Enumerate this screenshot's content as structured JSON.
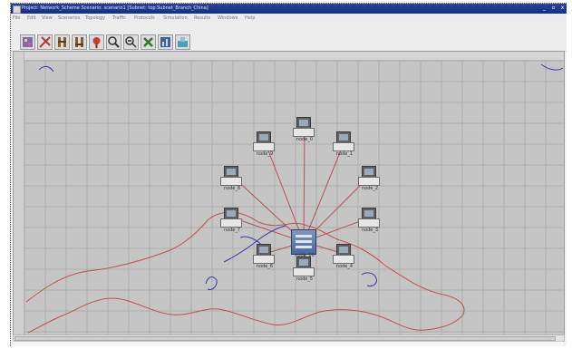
{
  "window": {
    "title": "Project: Network_Scheme Scenario: scenario1 [Subnet: top.Subnet_Branch_China]",
    "controls": [
      "_",
      "▫",
      "x"
    ]
  },
  "menu": [
    "File",
    "Edit",
    "View",
    "Scenarios",
    "Topology",
    "Traffic",
    "Protocols",
    "Simulation",
    "Results",
    "Windows",
    "Help"
  ],
  "toolbar": {
    "buttons": [
      {
        "icon": "open-palette-icon"
      },
      {
        "icon": "configure-links-icon"
      },
      {
        "icon": "verify-links-icon"
      },
      {
        "icon": "fail-node-icon"
      },
      {
        "icon": "recover-node-icon"
      },
      {
        "icon": "zoom-in-icon"
      },
      {
        "icon": "zoom-out-icon"
      },
      {
        "icon": "configure-sim-icon"
      },
      {
        "icon": "view-results-icon"
      },
      {
        "icon": "hide-graphs-icon"
      }
    ]
  },
  "canvas": {
    "background": "#c5c5c5",
    "grid_color": "#adadad",
    "link_color": "#b35252",
    "map_outline_color": "#c0504d",
    "annotation_color": "#3a3aa0",
    "hub_label": "node_10",
    "nodes": [
      "node_0",
      "node_1",
      "node_2",
      "node_3",
      "node_4",
      "node_5",
      "node_6",
      "node_7",
      "node_8",
      "node_9"
    ]
  }
}
